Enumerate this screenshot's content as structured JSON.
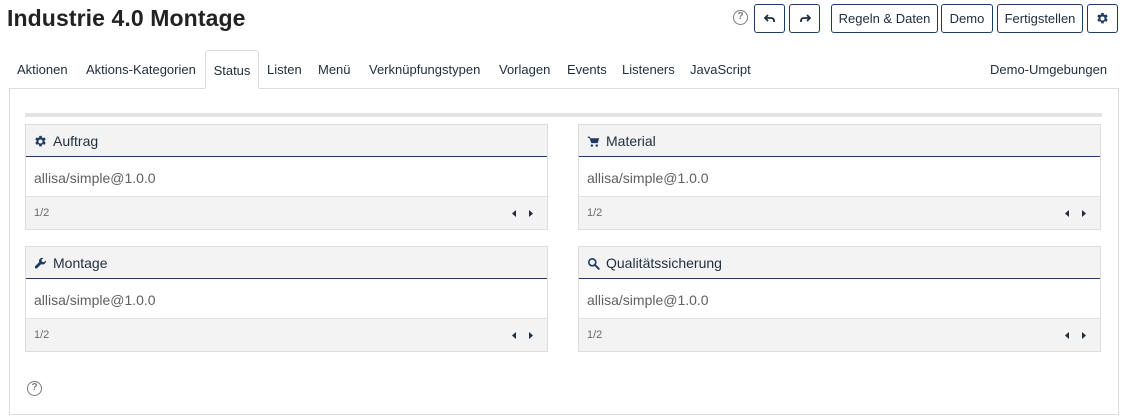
{
  "header": {
    "title": "Industrie 4.0 Montage",
    "help_glyph": "?",
    "buttons": {
      "undo_icon": "undo-icon",
      "redo_icon": "redo-icon",
      "rules_data": "Regeln & Daten",
      "demo": "Demo",
      "finish": "Fertigstellen",
      "settings_icon": "gear-icon"
    }
  },
  "tabs": [
    {
      "label": "Aktionen"
    },
    {
      "label": "Aktions-Kategorien"
    },
    {
      "label": "Status"
    },
    {
      "label": "Listen"
    },
    {
      "label": "Menü"
    },
    {
      "label": "Verknüpfungstypen"
    },
    {
      "label": "Vorlagen"
    },
    {
      "label": "Events"
    },
    {
      "label": "Listeners"
    },
    {
      "label": "JavaScript"
    }
  ],
  "active_tab": "Status",
  "demo_environments": "Demo-Umgebungen",
  "cards": [
    {
      "title": "Auftrag",
      "icon": "gear-icon",
      "value": "allisa/simple@1.0.0",
      "pager": "1/2"
    },
    {
      "title": "Material",
      "icon": "cart-icon",
      "value": "allisa/simple@1.0.0",
      "pager": "1/2"
    },
    {
      "title": "Montage",
      "icon": "wrench-icon",
      "value": "allisa/simple@1.0.0",
      "pager": "1/2"
    },
    {
      "title": "Qualitätssicherung",
      "icon": "search-icon",
      "value": "allisa/simple@1.0.0",
      "pager": "1/2"
    }
  ],
  "footer_help_glyph": "?",
  "colors": {
    "accent": "#1f3b63",
    "header_bg": "#f3f3f3",
    "text": "#1f2d3d"
  }
}
